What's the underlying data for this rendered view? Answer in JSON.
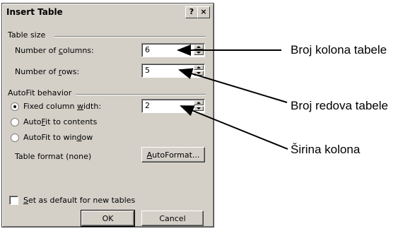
{
  "dialog": {
    "title": "Insert Table",
    "help_button": "?",
    "close_button": "×",
    "table_size_label": "Table size",
    "columns_label_pre": "Number of ",
    "columns_label_u": "c",
    "columns_label_post": "olumns:",
    "columns_value": "6",
    "rows_label_pre": "Number of ",
    "rows_label_u": "r",
    "rows_label_post": "ows:",
    "rows_value": "5",
    "autofit_label": "AutoFit behavior",
    "fixed_pre": "Fixed column ",
    "fixed_u": "w",
    "fixed_post": "idth:",
    "fixed_value": "2",
    "autofit_contents_pre": "Auto",
    "autofit_contents_u": "F",
    "autofit_contents_post": "it to contents",
    "autofit_window_pre": "AutoFit to win",
    "autofit_window_u": "d",
    "autofit_window_post": "ow",
    "table_format_label": "Table format  (none)",
    "autoformat_u": "A",
    "autoformat_post": "utoFormat...",
    "set_default_u": "S",
    "set_default_post": "et as default for new tables",
    "ok_label": "OK",
    "cancel_label": "Cancel"
  },
  "callouts": {
    "columns": "Broj kolona tabele",
    "rows": "Broj redova tabele",
    "width": "Širina kolona"
  }
}
